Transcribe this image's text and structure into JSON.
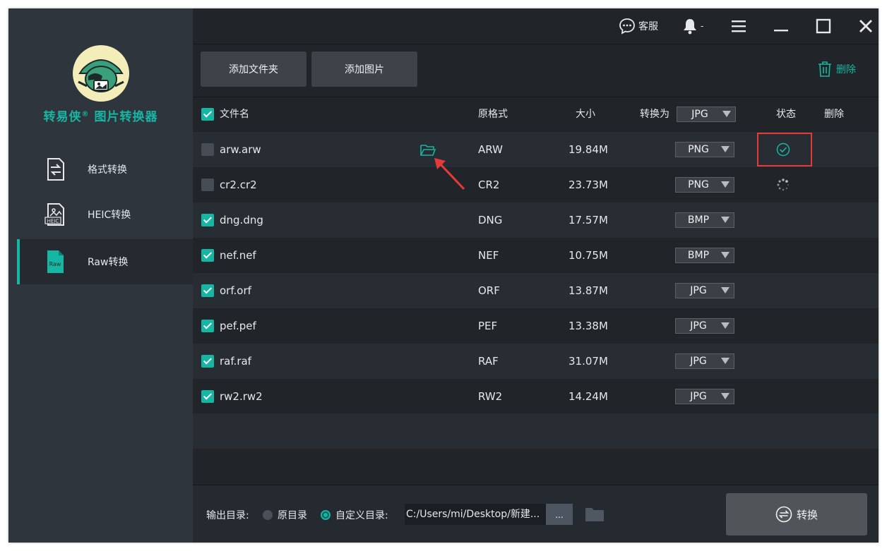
{
  "app": {
    "title": "转易侠",
    "title_mark": "®",
    "subtitle": "图片转换器",
    "accent": "#16b6a4"
  },
  "sidebar": {
    "items": [
      {
        "label": "格式转换",
        "icon": "format-convert-icon",
        "active": false
      },
      {
        "label": "HEIC转换",
        "icon": "heic-icon",
        "active": false,
        "icon_text": "HEIC"
      },
      {
        "label": "Raw转换",
        "icon": "raw-icon",
        "active": true,
        "icon_text": "Raw"
      }
    ]
  },
  "titlebar": {
    "service_label": "客服",
    "notify_label": "-"
  },
  "toolbar": {
    "add_folder": "添加文件夹",
    "add_image": "添加图片",
    "delete": "删除"
  },
  "table": {
    "headers": {
      "name": "文件名",
      "format": "原格式",
      "size": "大小",
      "convert_to": "转换为",
      "convert_to_value": "JPG",
      "status": "状态",
      "delete": "删除"
    },
    "rows": [
      {
        "name": "arw.arw",
        "format": "ARW",
        "size": "19.84M",
        "target": "PNG",
        "checked": false,
        "status": "done",
        "show_folder": true
      },
      {
        "name": "cr2.cr2",
        "format": "CR2",
        "size": "23.73M",
        "target": "PNG",
        "checked": false,
        "status": "loading",
        "show_folder": false
      },
      {
        "name": "dng.dng",
        "format": "DNG",
        "size": "17.57M",
        "target": "BMP",
        "checked": true,
        "status": "",
        "show_folder": false
      },
      {
        "name": "nef.nef",
        "format": "NEF",
        "size": "10.75M",
        "target": "BMP",
        "checked": true,
        "status": "",
        "show_folder": false
      },
      {
        "name": "orf.orf",
        "format": "ORF",
        "size": "13.87M",
        "target": "JPG",
        "checked": true,
        "status": "",
        "show_folder": false
      },
      {
        "name": "pef.pef",
        "format": "PEF",
        "size": "13.38M",
        "target": "JPG",
        "checked": true,
        "status": "",
        "show_folder": false
      },
      {
        "name": "raf.raf",
        "format": "RAF",
        "size": "31.07M",
        "target": "JPG",
        "checked": true,
        "status": "",
        "show_folder": false
      },
      {
        "name": "rw2.rw2",
        "format": "RW2",
        "size": "14.24M",
        "target": "JPG",
        "checked": true,
        "status": "",
        "show_folder": false
      }
    ]
  },
  "footer": {
    "output_label": "输出目录:",
    "opt_original": "原目录",
    "opt_custom": "自定义目录:",
    "selected": "custom",
    "path": "C:/Users/mi/Desktop/新建...",
    "browse": "...",
    "convert": "转换"
  },
  "colors": {
    "highlight": "#e63a3a",
    "arrow": "#e63a3a"
  }
}
